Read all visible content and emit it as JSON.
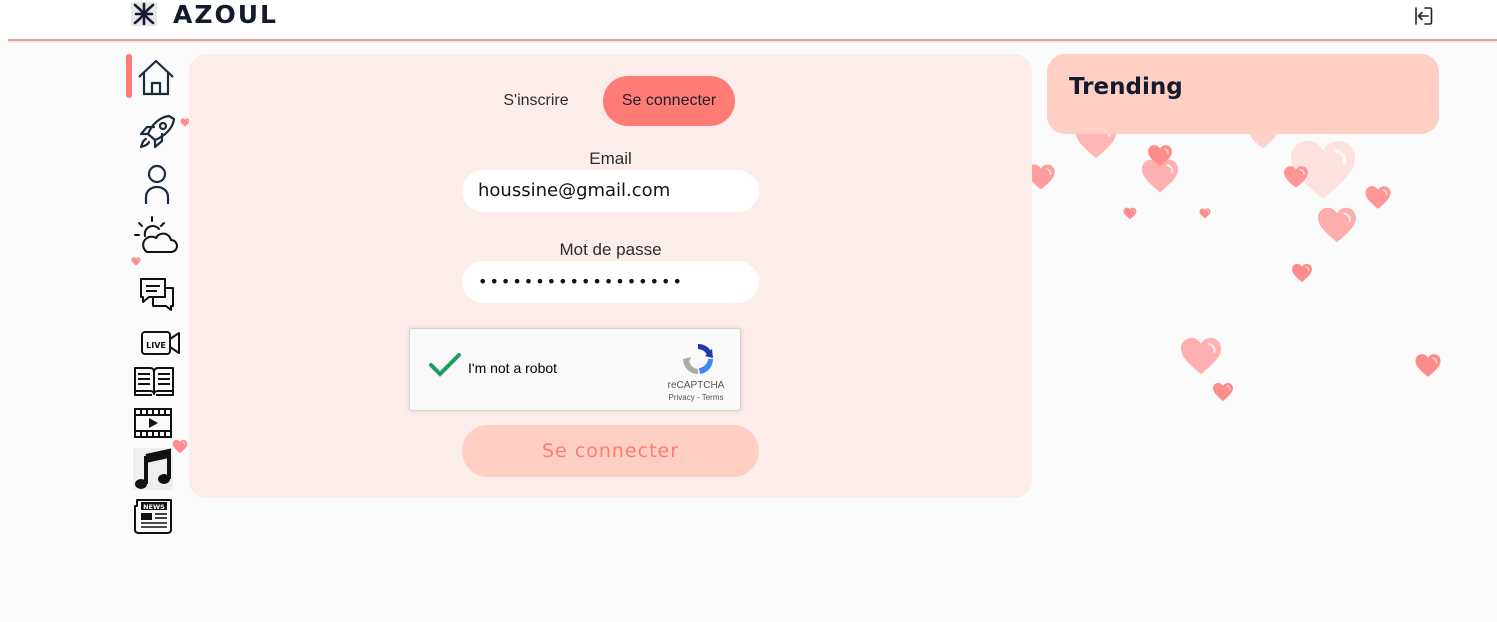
{
  "header": {
    "brand_name": "AZOUL",
    "logo_icon": "yaz-symbol-icon",
    "logout_icon": "logout-icon"
  },
  "sidebar": {
    "active_index": 0,
    "items": [
      {
        "name": "home",
        "icon": "home-icon"
      },
      {
        "name": "explore",
        "icon": "rocket-icon"
      },
      {
        "name": "profile",
        "icon": "user-icon"
      },
      {
        "name": "weather",
        "icon": "weather-icon"
      },
      {
        "name": "chat",
        "icon": "chat-icon"
      },
      {
        "name": "live",
        "icon": "live-video-icon",
        "badge": "LIVE"
      },
      {
        "name": "books",
        "icon": "book-icon"
      },
      {
        "name": "videos",
        "icon": "film-play-icon"
      },
      {
        "name": "music",
        "icon": "music-note-icon"
      },
      {
        "name": "news",
        "icon": "newspaper-icon",
        "badge": "NEWS"
      }
    ]
  },
  "auth": {
    "tabs": [
      {
        "label": "S'inscrire",
        "active": false
      },
      {
        "label": "Se connecter",
        "active": true
      }
    ],
    "email_label": "Email",
    "email_value": "houssine@gmail.com",
    "password_label": "Mot de passe",
    "password_value": "••••••••••••••••••",
    "captcha": {
      "label": "I'm not a robot",
      "checked": true,
      "brand": "reCAPTCHA",
      "links": "Privacy - Terms"
    },
    "submit_label": "Se connecter"
  },
  "trending": {
    "title": "Trending"
  },
  "colors": {
    "accent": "#ff7b76",
    "card_bg": "#fcecea",
    "trending_bg": "#ffcfc3",
    "heart": "#ff8c8c"
  }
}
